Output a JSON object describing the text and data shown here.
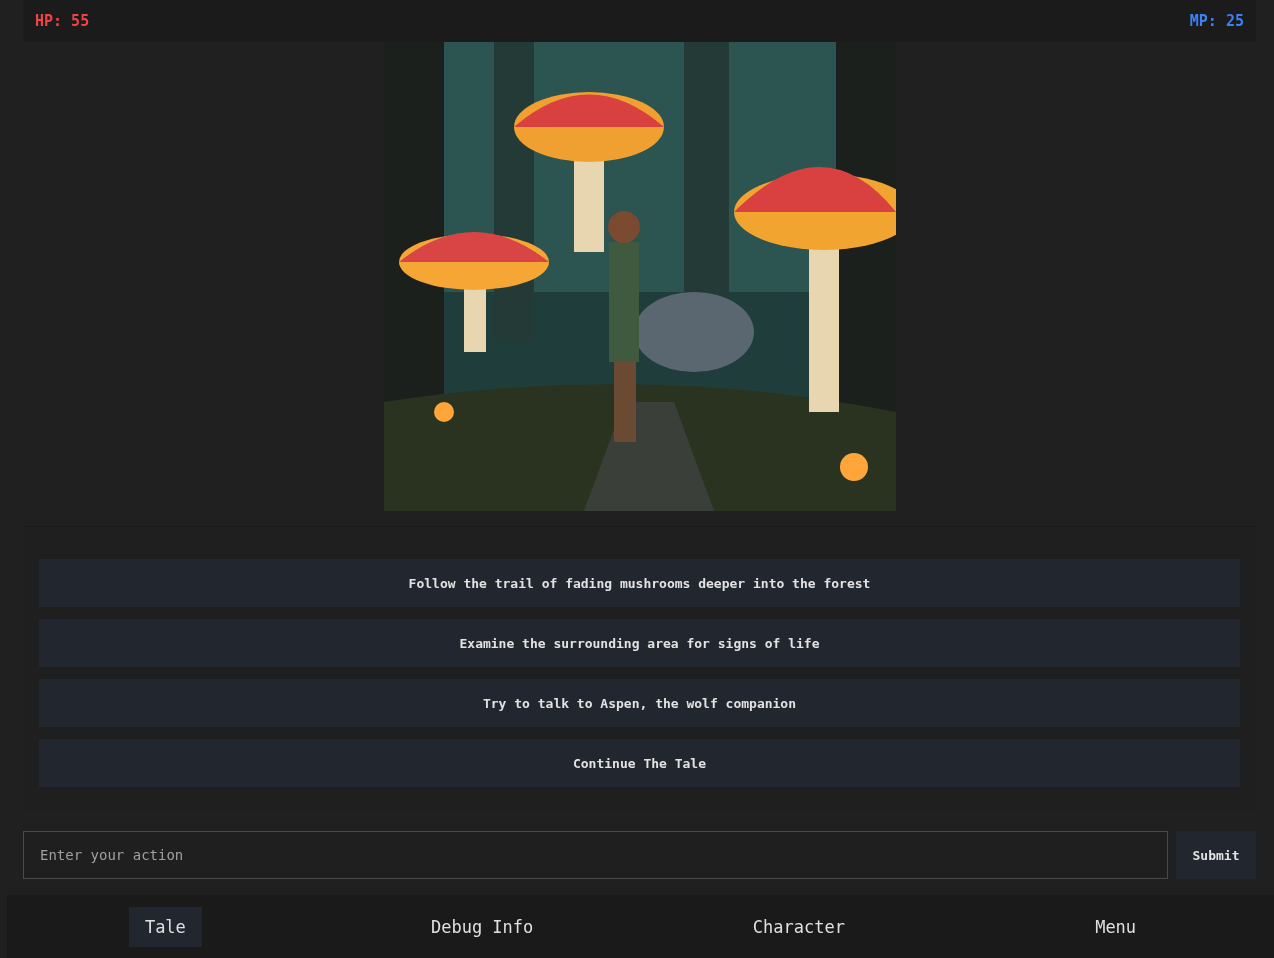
{
  "stats": {
    "hp": "HP: 55",
    "mp": "MP: 25"
  },
  "choices": [
    "Follow the trail of fading mushrooms deeper into the forest",
    "Examine the surrounding area for signs of life",
    "Try to talk to Aspen, the wolf companion",
    "Continue The Tale"
  ],
  "action": {
    "placeholder": "Enter your action",
    "submit": "Submit"
  },
  "nav": [
    {
      "label": "Tale",
      "selected": true
    },
    {
      "label": "Debug Info",
      "selected": false
    },
    {
      "label": "Character",
      "selected": false
    },
    {
      "label": "Menu",
      "selected": false
    }
  ]
}
